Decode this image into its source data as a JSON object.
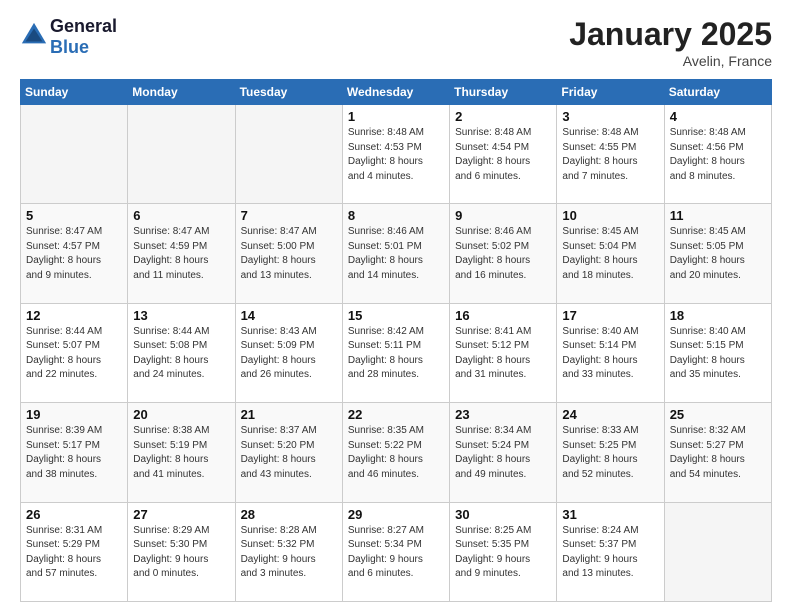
{
  "header": {
    "logo_line1": "General",
    "logo_line2": "Blue",
    "month": "January 2025",
    "location": "Avelin, France"
  },
  "weekdays": [
    "Sunday",
    "Monday",
    "Tuesday",
    "Wednesday",
    "Thursday",
    "Friday",
    "Saturday"
  ],
  "weeks": [
    [
      {
        "day": "",
        "info": ""
      },
      {
        "day": "",
        "info": ""
      },
      {
        "day": "",
        "info": ""
      },
      {
        "day": "1",
        "info": "Sunrise: 8:48 AM\nSunset: 4:53 PM\nDaylight: 8 hours\nand 4 minutes."
      },
      {
        "day": "2",
        "info": "Sunrise: 8:48 AM\nSunset: 4:54 PM\nDaylight: 8 hours\nand 6 minutes."
      },
      {
        "day": "3",
        "info": "Sunrise: 8:48 AM\nSunset: 4:55 PM\nDaylight: 8 hours\nand 7 minutes."
      },
      {
        "day": "4",
        "info": "Sunrise: 8:48 AM\nSunset: 4:56 PM\nDaylight: 8 hours\nand 8 minutes."
      }
    ],
    [
      {
        "day": "5",
        "info": "Sunrise: 8:47 AM\nSunset: 4:57 PM\nDaylight: 8 hours\nand 9 minutes."
      },
      {
        "day": "6",
        "info": "Sunrise: 8:47 AM\nSunset: 4:59 PM\nDaylight: 8 hours\nand 11 minutes."
      },
      {
        "day": "7",
        "info": "Sunrise: 8:47 AM\nSunset: 5:00 PM\nDaylight: 8 hours\nand 13 minutes."
      },
      {
        "day": "8",
        "info": "Sunrise: 8:46 AM\nSunset: 5:01 PM\nDaylight: 8 hours\nand 14 minutes."
      },
      {
        "day": "9",
        "info": "Sunrise: 8:46 AM\nSunset: 5:02 PM\nDaylight: 8 hours\nand 16 minutes."
      },
      {
        "day": "10",
        "info": "Sunrise: 8:45 AM\nSunset: 5:04 PM\nDaylight: 8 hours\nand 18 minutes."
      },
      {
        "day": "11",
        "info": "Sunrise: 8:45 AM\nSunset: 5:05 PM\nDaylight: 8 hours\nand 20 minutes."
      }
    ],
    [
      {
        "day": "12",
        "info": "Sunrise: 8:44 AM\nSunset: 5:07 PM\nDaylight: 8 hours\nand 22 minutes."
      },
      {
        "day": "13",
        "info": "Sunrise: 8:44 AM\nSunset: 5:08 PM\nDaylight: 8 hours\nand 24 minutes."
      },
      {
        "day": "14",
        "info": "Sunrise: 8:43 AM\nSunset: 5:09 PM\nDaylight: 8 hours\nand 26 minutes."
      },
      {
        "day": "15",
        "info": "Sunrise: 8:42 AM\nSunset: 5:11 PM\nDaylight: 8 hours\nand 28 minutes."
      },
      {
        "day": "16",
        "info": "Sunrise: 8:41 AM\nSunset: 5:12 PM\nDaylight: 8 hours\nand 31 minutes."
      },
      {
        "day": "17",
        "info": "Sunrise: 8:40 AM\nSunset: 5:14 PM\nDaylight: 8 hours\nand 33 minutes."
      },
      {
        "day": "18",
        "info": "Sunrise: 8:40 AM\nSunset: 5:15 PM\nDaylight: 8 hours\nand 35 minutes."
      }
    ],
    [
      {
        "day": "19",
        "info": "Sunrise: 8:39 AM\nSunset: 5:17 PM\nDaylight: 8 hours\nand 38 minutes."
      },
      {
        "day": "20",
        "info": "Sunrise: 8:38 AM\nSunset: 5:19 PM\nDaylight: 8 hours\nand 41 minutes."
      },
      {
        "day": "21",
        "info": "Sunrise: 8:37 AM\nSunset: 5:20 PM\nDaylight: 8 hours\nand 43 minutes."
      },
      {
        "day": "22",
        "info": "Sunrise: 8:35 AM\nSunset: 5:22 PM\nDaylight: 8 hours\nand 46 minutes."
      },
      {
        "day": "23",
        "info": "Sunrise: 8:34 AM\nSunset: 5:24 PM\nDaylight: 8 hours\nand 49 minutes."
      },
      {
        "day": "24",
        "info": "Sunrise: 8:33 AM\nSunset: 5:25 PM\nDaylight: 8 hours\nand 52 minutes."
      },
      {
        "day": "25",
        "info": "Sunrise: 8:32 AM\nSunset: 5:27 PM\nDaylight: 8 hours\nand 54 minutes."
      }
    ],
    [
      {
        "day": "26",
        "info": "Sunrise: 8:31 AM\nSunset: 5:29 PM\nDaylight: 8 hours\nand 57 minutes."
      },
      {
        "day": "27",
        "info": "Sunrise: 8:29 AM\nSunset: 5:30 PM\nDaylight: 9 hours\nand 0 minutes."
      },
      {
        "day": "28",
        "info": "Sunrise: 8:28 AM\nSunset: 5:32 PM\nDaylight: 9 hours\nand 3 minutes."
      },
      {
        "day": "29",
        "info": "Sunrise: 8:27 AM\nSunset: 5:34 PM\nDaylight: 9 hours\nand 6 minutes."
      },
      {
        "day": "30",
        "info": "Sunrise: 8:25 AM\nSunset: 5:35 PM\nDaylight: 9 hours\nand 9 minutes."
      },
      {
        "day": "31",
        "info": "Sunrise: 8:24 AM\nSunset: 5:37 PM\nDaylight: 9 hours\nand 13 minutes."
      },
      {
        "day": "",
        "info": ""
      }
    ]
  ]
}
